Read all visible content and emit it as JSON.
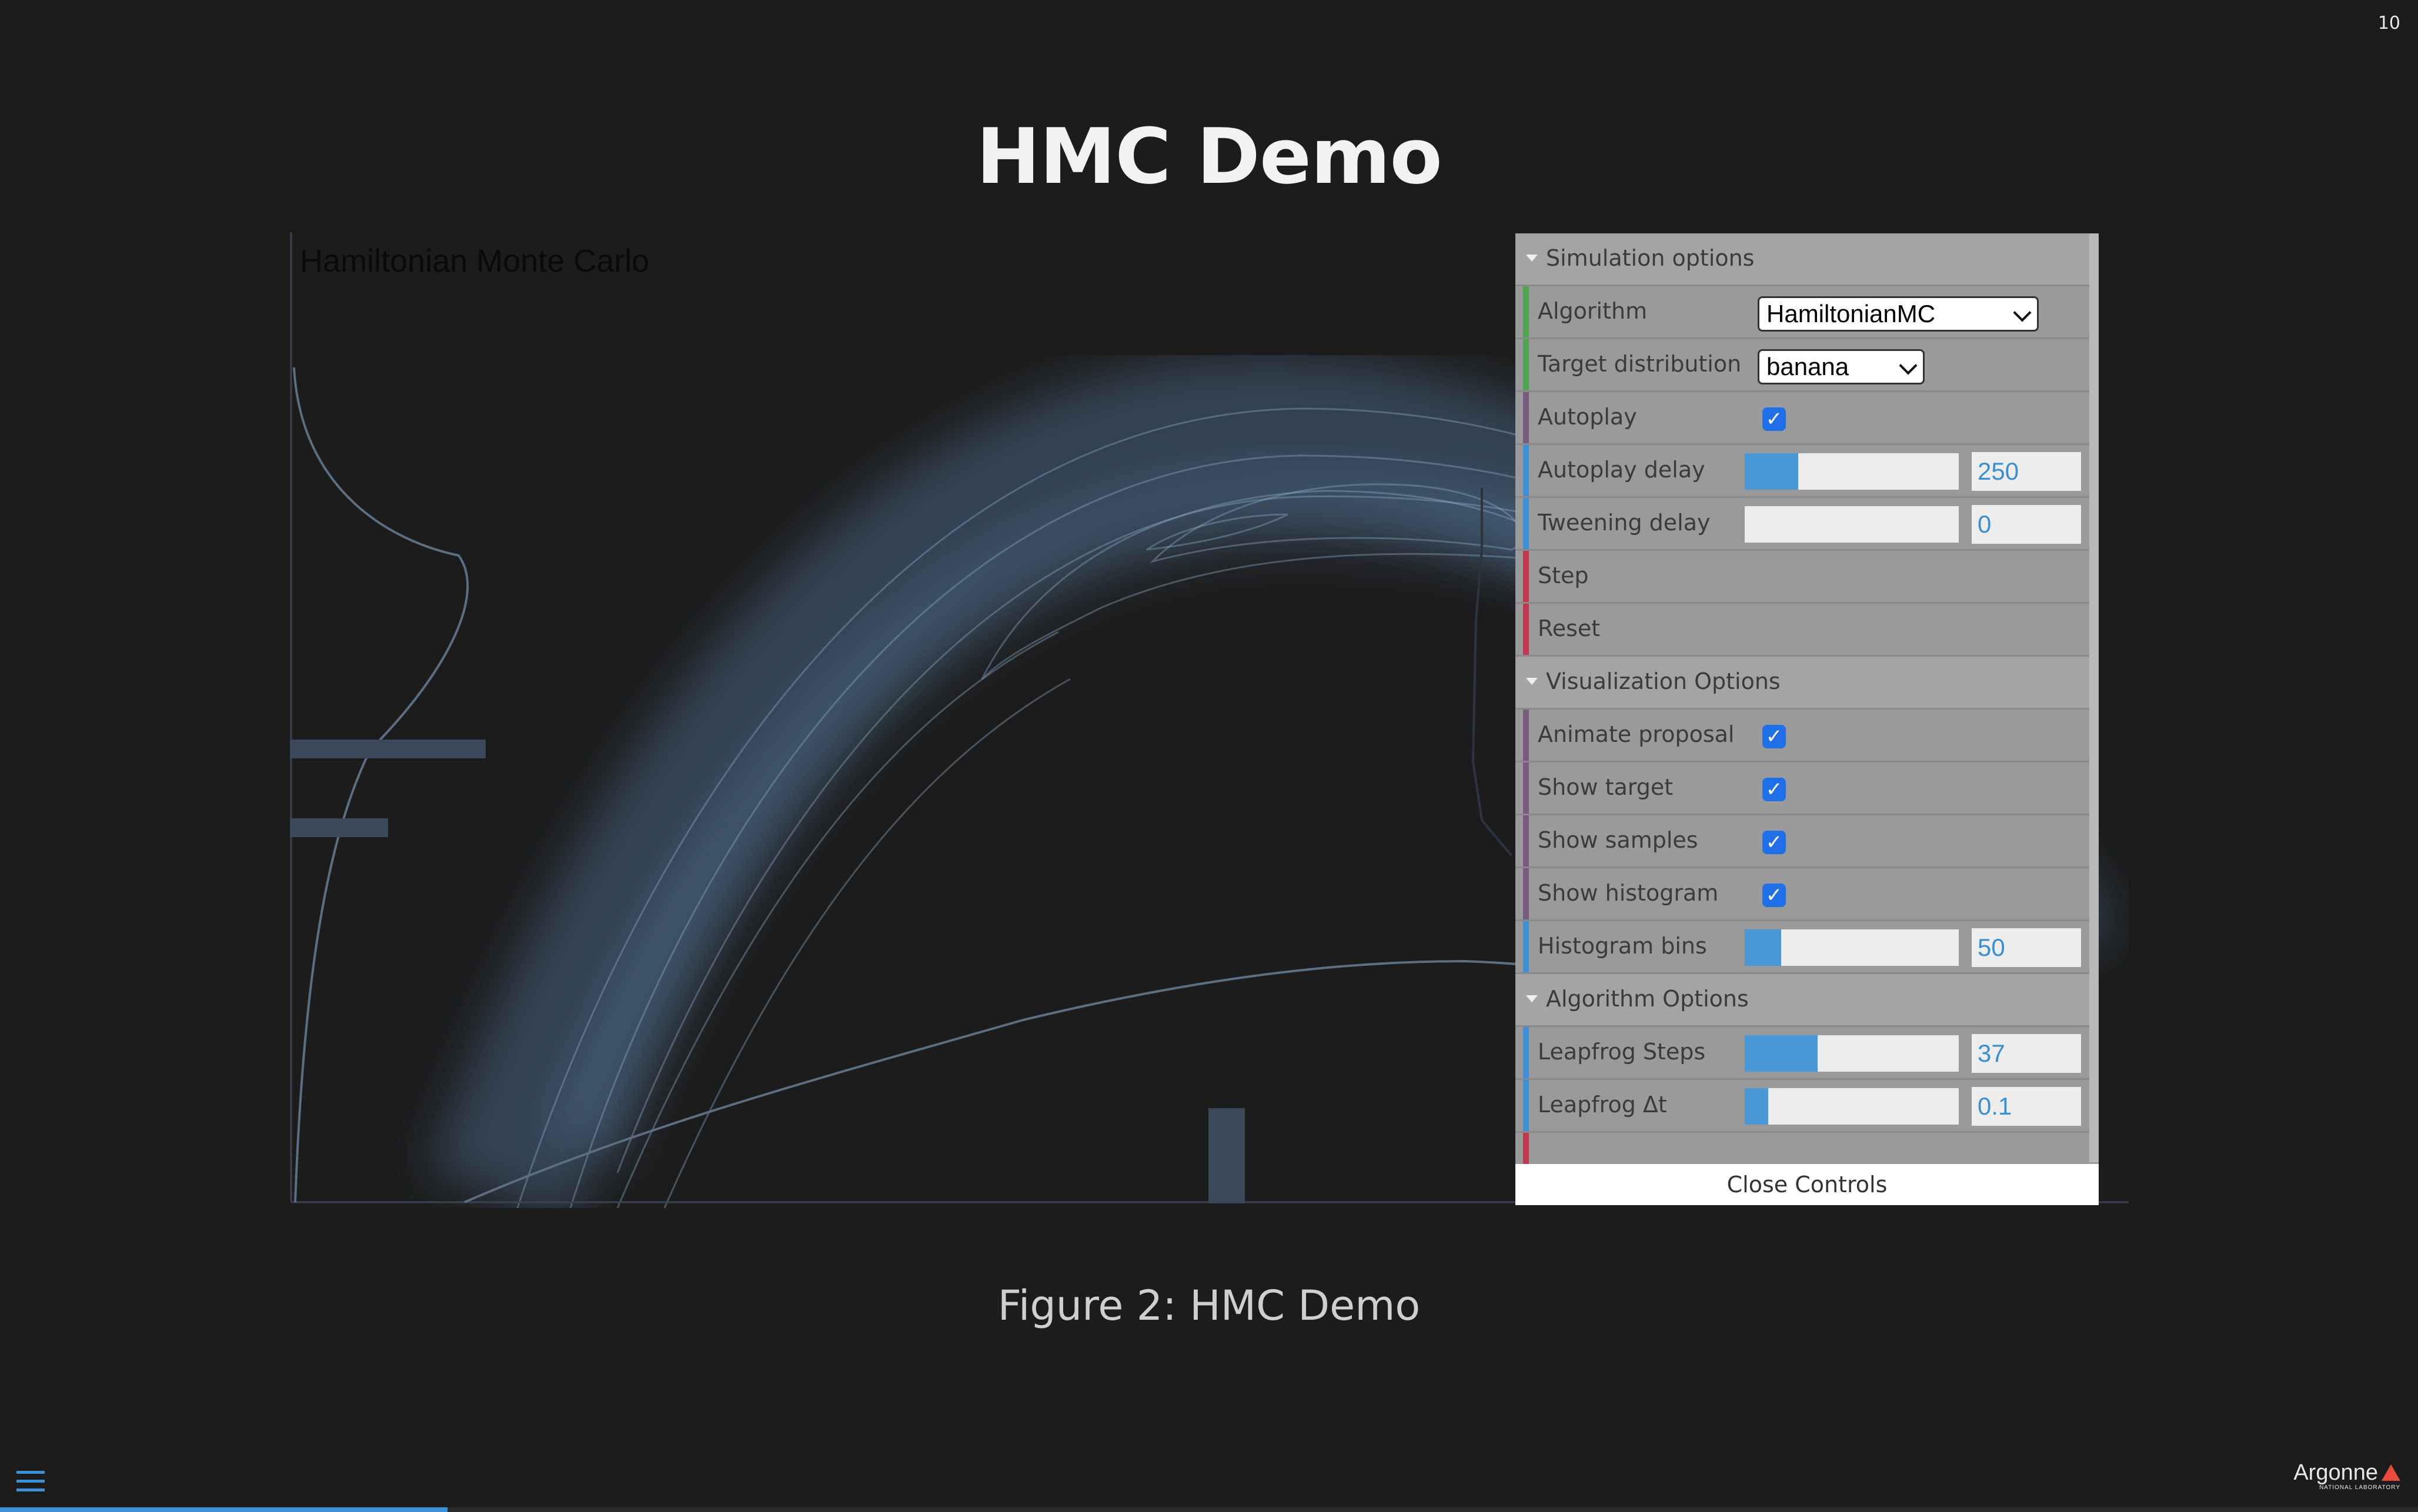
{
  "slide": {
    "number": "10",
    "title": "HMC Demo",
    "caption": "Figure 2: HMC Demo",
    "progress_fraction": 0.185
  },
  "visualization": {
    "title": "Hamiltonian Monte Carlo"
  },
  "controls": {
    "simulation_folder": "Simulation options",
    "algorithm_label": "Algorithm",
    "algorithm_value": "HamiltonianMC",
    "target_label": "Target distribution",
    "target_value": "banana",
    "autoplay_label": "Autoplay",
    "autoplay_checked": true,
    "autoplay_delay_label": "Autoplay delay",
    "autoplay_delay_value": "250",
    "autoplay_delay_fraction": 0.25,
    "tweening_delay_label": "Tweening delay",
    "tweening_delay_value": "0",
    "tweening_delay_fraction": 0.0,
    "step_label": "Step",
    "reset_label": "Reset",
    "visualization_folder": "Visualization Options",
    "animate_proposal_label": "Animate proposal",
    "show_target_label": "Show target",
    "show_samples_label": "Show samples",
    "show_histogram_label": "Show histogram",
    "histogram_bins_label": "Histogram bins",
    "histogram_bins_value": "50",
    "histogram_bins_fraction": 0.17,
    "algorithm_folder": "Algorithm Options",
    "leapfrog_steps_label": "Leapfrog Steps",
    "leapfrog_steps_value": "37",
    "leapfrog_steps_fraction": 0.34,
    "leapfrog_dt_label": "Leapfrog Δt",
    "leapfrog_dt_value": "0.1",
    "leapfrog_dt_fraction": 0.11,
    "close_label": "Close Controls"
  },
  "colors": {
    "accent": "#3d8fd6",
    "checkbox": "#1f6fe8",
    "bar_green": "#4fa552",
    "bar_purple": "#7a5b7f",
    "bar_blue": "#3d8fd6",
    "bar_red": "#c0384f"
  },
  "icons": {
    "menu": "hamburger-menu-icon",
    "logo": "argonne-logo"
  },
  "logo": {
    "name": "Argonne",
    "sub": "NATIONAL LABORATORY"
  }
}
